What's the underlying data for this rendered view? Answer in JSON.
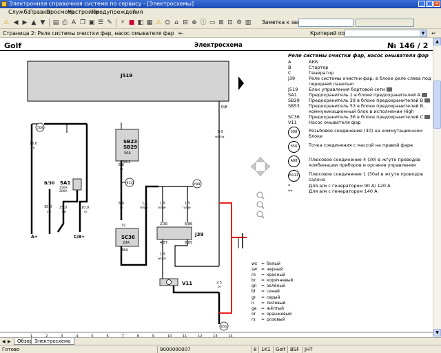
{
  "window": {
    "title": "Электронная справочная система по сервису - [Электросхемы]"
  },
  "menu": {
    "items": [
      "Служба",
      "Правка",
      "Просмотр",
      "Настройки",
      "Предупреждения",
      "?"
    ]
  },
  "toolbar": {
    "order_note_label": "Заметка к заказу:"
  },
  "pagebar": {
    "page_label": "Страница 2: Реле системы очистки фар, насос омывателя фар",
    "search_criteria_label": "Критерий поиска:"
  },
  "document": {
    "model": "Golf",
    "title": "Электросхема",
    "page_number": "№  146 / 2"
  },
  "diagram": {
    "unit_j519": "J519",
    "fuse_sb23": "SB23",
    "fuse_sb29": "SB29",
    "fuse_sb_rating": "50A",
    "fuse_sc36": "SC36",
    "fuse_sc36_rating": "20A",
    "relay_j39": "J39",
    "pump_v11": "V11",
    "battery_a": "A+",
    "starter_b": "B/30",
    "generator_c": "C/B+",
    "sa1": "SA1",
    "sa1_rating_a": "150A",
    "sa1_rating_b": "200A",
    "conn_508": "508",
    "conn_b111": "B111",
    "conn_a98": "A98",
    "conn_656": "656",
    "t40_2": "T40/2",
    "pins": {
      "p30": "30",
      "p31": "31",
      "p32": "32",
      "p36a": "36A",
      "p2_30": "2/30",
      "p6_86": "6/86",
      "p4_87": "4/87",
      "p8_85": "8/85"
    },
    "wires": {
      "w_16_ro": "16,0",
      "w_16_ro_c": "ro",
      "w_60_ro": "6,0",
      "w_60_ro_c": "ro",
      "w_300_sw": "30,0",
      "w_300_sw_c": "sw",
      "w_25_sw": "25,0",
      "w_25_sw_c": "sw",
      "w_100_ro": "10,0",
      "w_100_ro_c": "ro",
      "w_60b": "6,0",
      "w_60b_c": "ro",
      "w_60c": "6,0",
      "w_60c_c": "ro",
      "w_15_a": "1,5",
      "w_15_a_c": "ro/ge",
      "w_15_b": "1,5",
      "w_15_b_c": "ro/ge",
      "w_15_c": "1,5",
      "w_15_c_c": "ro/ge",
      "w_15_d": "1,5",
      "w_15_d_c": "ws/ro",
      "w_05": "0,5",
      "w_05_c": "ws/sw",
      "w_08": "D/8",
      "w_25br": "2,5",
      "w_25br_c": "br"
    },
    "grid_numbers": [
      "1",
      "2",
      "3",
      "4",
      "5",
      "6",
      "7",
      "8",
      "9",
      "10",
      "11",
      "12",
      "13",
      "14"
    ]
  },
  "legend": {
    "heading": "Реле системы очистки фар, насос омывателя фар",
    "entries": [
      {
        "code": "A",
        "text": "АКБ"
      },
      {
        "code": "B",
        "text": "Стартер"
      },
      {
        "code": "C",
        "text": "Генератор"
      },
      {
        "code": "J39",
        "text": "Реле системы очистки фар, в блоке реле слева под передней панелью"
      },
      {
        "code": "J519",
        "text": "Блок управления бортовой сети"
      },
      {
        "code": "SA1",
        "text": "Предохранитель 1 в блоке предохранителей A"
      },
      {
        "code": "SB29",
        "text": "Предохранитель 29 в блоке предохранителей B"
      },
      {
        "code": "SB53",
        "text": "Предохранитель 53 в блоке предохранителей B, коммуникационный блок в исполнении High"
      },
      {
        "code": "SC36",
        "text": "Предохранитель 36 в блоке предохранителей C"
      },
      {
        "code": "V11",
        "text": "Насос омывателя фар"
      }
    ],
    "circled": [
      {
        "code": "508",
        "text": "Резьбовое соединение (30) на коммутационном блоке"
      },
      {
        "code": "656",
        "text": "Точка соединения с массой на правой фаре"
      },
      {
        "code": "A98",
        "text": "Плюсовое соединение 4 (30) в жгуте проводов комбинации приборов и органов управления"
      },
      {
        "code": "B111",
        "text": "Плюсовое соединение 1 (30a) в жгуте проводов салона"
      }
    ],
    "notes": [
      {
        "code": "*",
        "text": "Для а/м с генератором 90 A/ 120 A"
      },
      {
        "code": "**",
        "text": "Для а/м с генератором 140 A"
      }
    ]
  },
  "color_key": [
    {
      "code": "ws",
      "name": "белый"
    },
    {
      "code": "sw",
      "name": "черный"
    },
    {
      "code": "ro",
      "name": "красный"
    },
    {
      "code": "br",
      "name": "коричневый"
    },
    {
      "code": "gn",
      "name": "зелёный"
    },
    {
      "code": "bl",
      "name": "синий"
    },
    {
      "code": "gr",
      "name": "серый"
    },
    {
      "code": "li",
      "name": "лиловый"
    },
    {
      "code": "ge",
      "name": "жёлтый"
    },
    {
      "code": "or",
      "name": "оранжевый"
    },
    {
      "code": "rs",
      "name": "розовый"
    }
  ],
  "tabs": {
    "items": [
      "Обзор",
      "Электросхема"
    ],
    "active": "Электросхема"
  },
  "statusbar": {
    "ready": "Готово",
    "order_number": "9000000007",
    "cells": [
      "8",
      "1K1",
      "Golf",
      "BSF",
      "JHT"
    ]
  },
  "colors": {
    "red_wire": "#e8201c",
    "black_wire": "#000000",
    "unit_fill": "#d4d4d4",
    "title_bar": "#1c4bb6"
  }
}
